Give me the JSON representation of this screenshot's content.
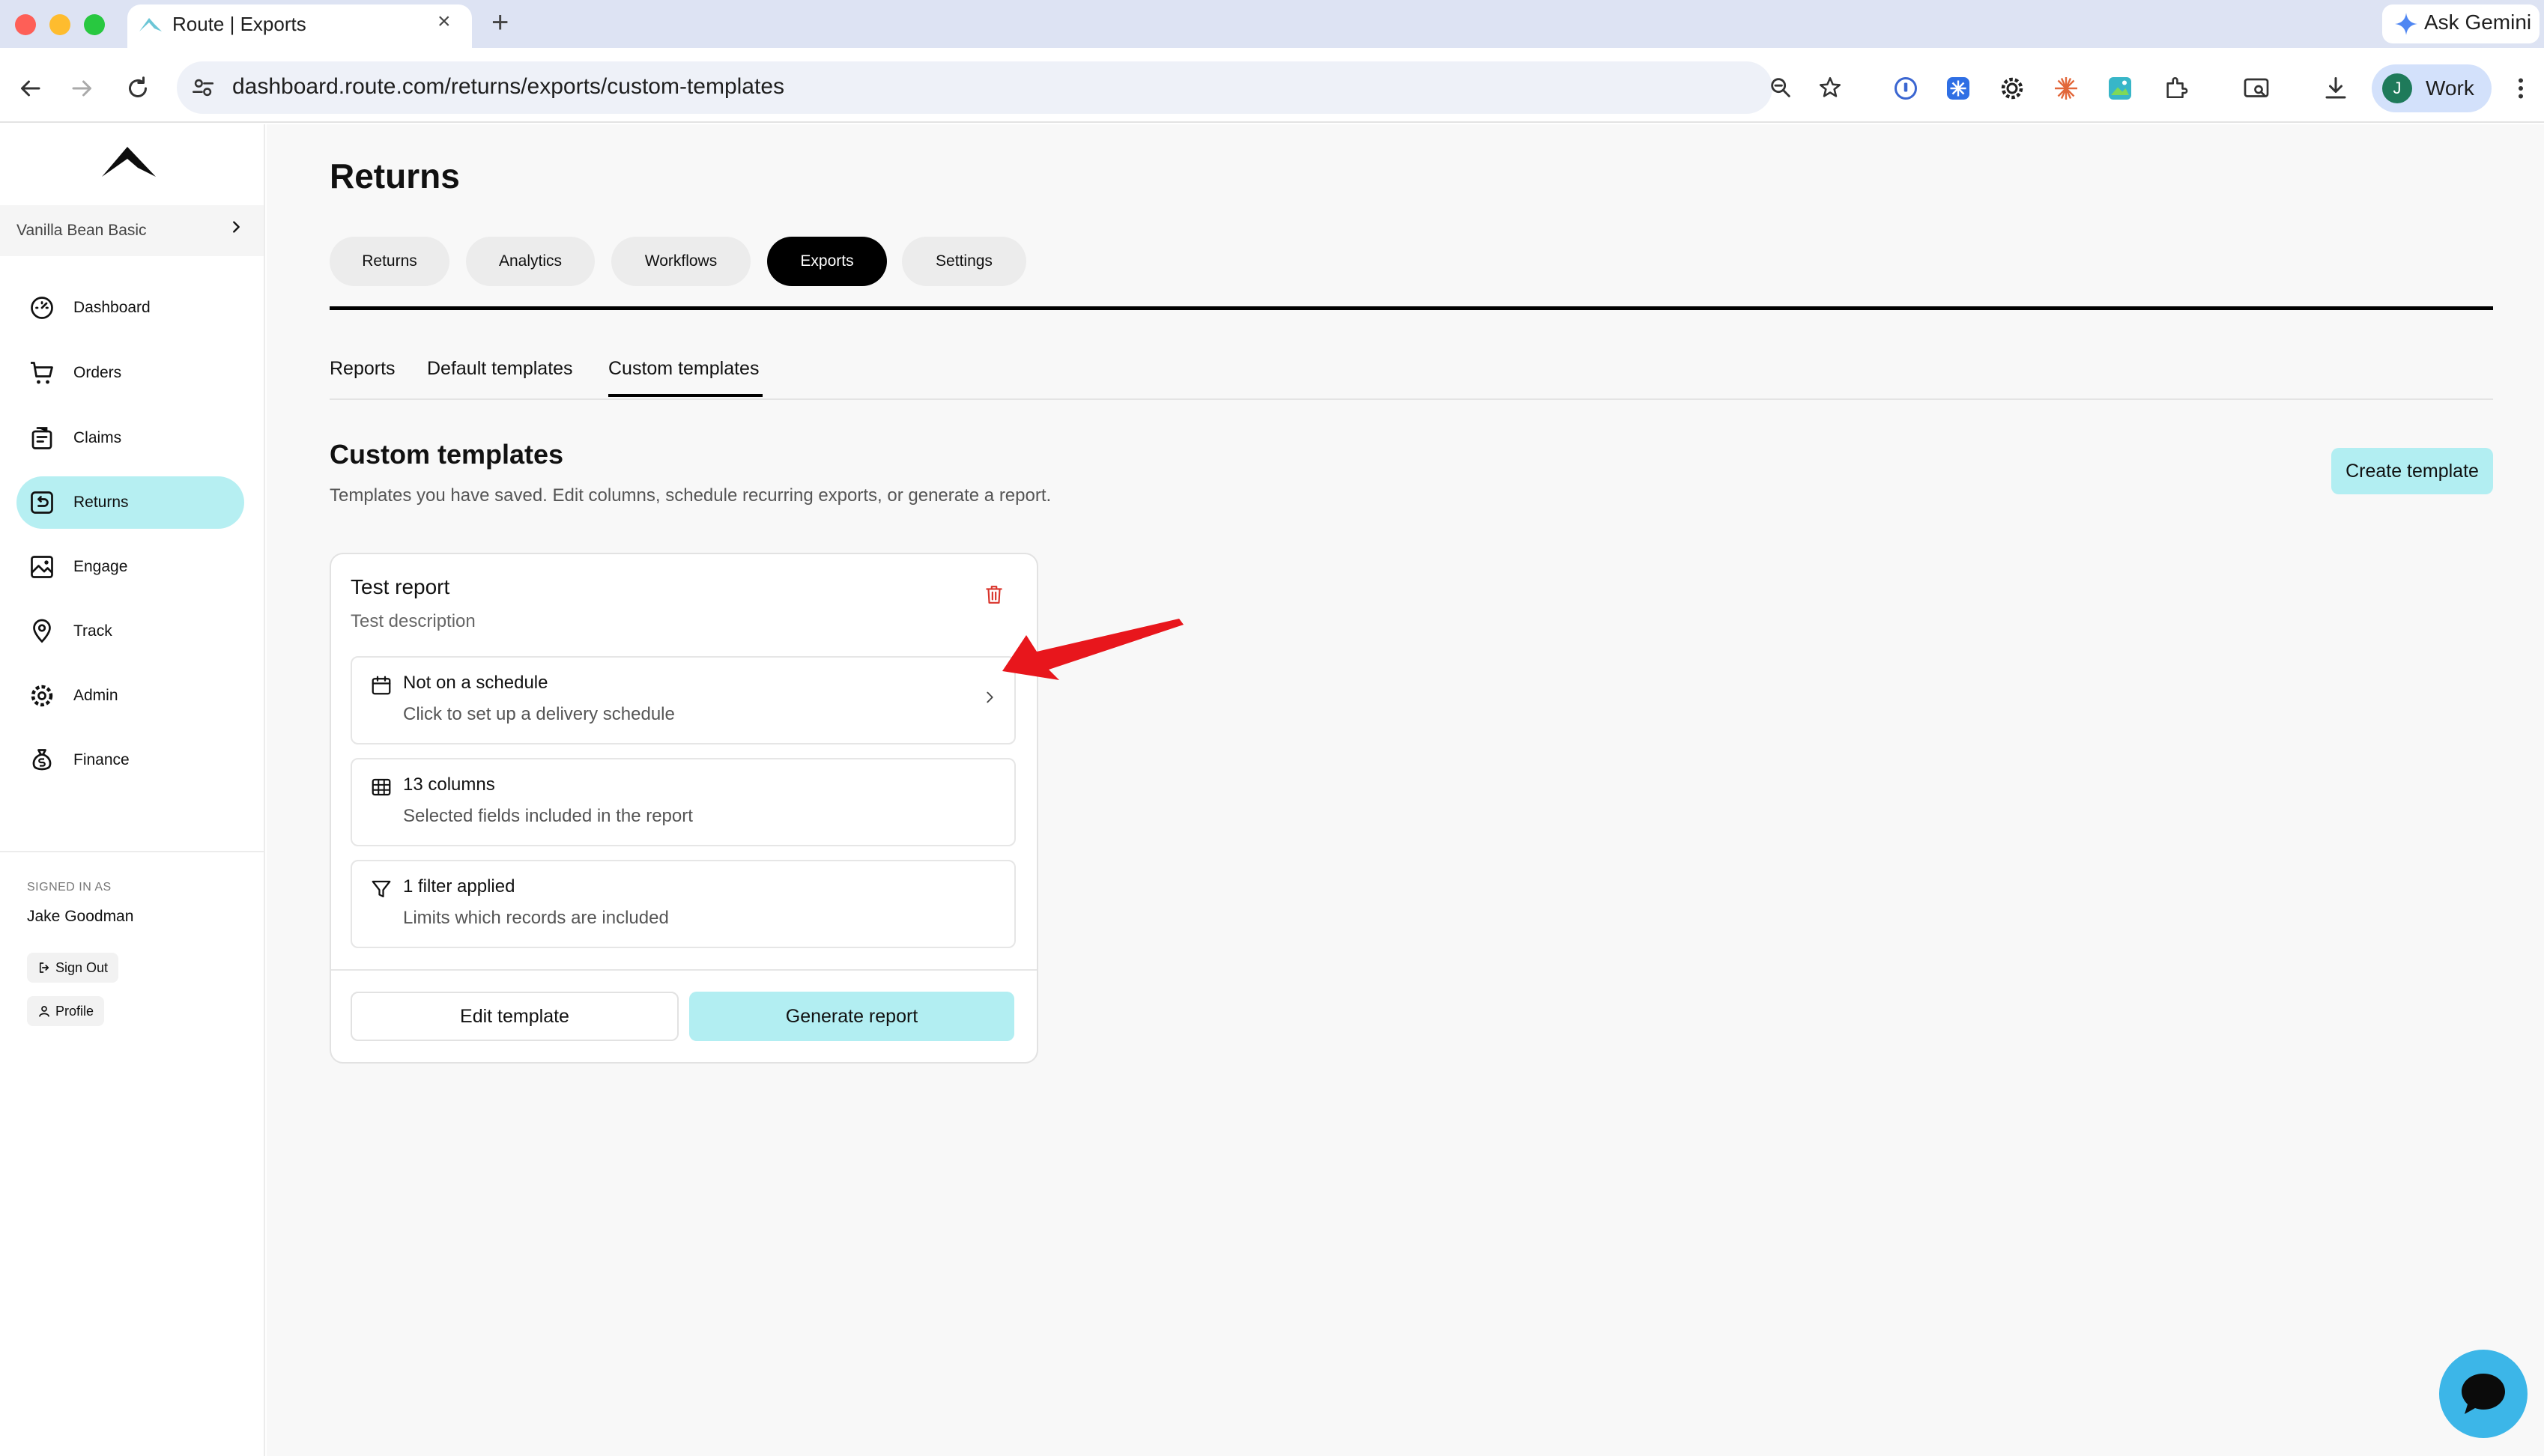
{
  "browser": {
    "tab_title": "Route | Exports",
    "url": "dashboard.route.com/returns/exports/custom-templates",
    "gemini_label": "Ask Gemini",
    "profile_initial": "J",
    "profile_label": "Work"
  },
  "sidebar": {
    "org_name": "Vanilla Bean Basic",
    "items": [
      {
        "label": "Dashboard",
        "icon": "dashboard-icon"
      },
      {
        "label": "Orders",
        "icon": "cart-icon"
      },
      {
        "label": "Claims",
        "icon": "claims-icon"
      },
      {
        "label": "Returns",
        "icon": "returns-icon",
        "active": true
      },
      {
        "label": "Engage",
        "icon": "image-icon"
      },
      {
        "label": "Track",
        "icon": "location-pin-icon"
      },
      {
        "label": "Admin",
        "icon": "gear-icon"
      },
      {
        "label": "Finance",
        "icon": "money-bag-icon"
      }
    ],
    "signed_in_caption": "SIGNED IN AS",
    "user_name": "Jake Goodman",
    "sign_out_label": "Sign Out",
    "profile_label": "Profile"
  },
  "main": {
    "title": "Returns",
    "pills": [
      "Returns",
      "Analytics",
      "Workflows",
      "Exports",
      "Settings"
    ],
    "active_pill": "Exports",
    "subtabs": [
      "Reports",
      "Default templates",
      "Custom templates"
    ],
    "active_subtab": "Custom templates",
    "section_title": "Custom templates",
    "section_desc": "Templates you have saved. Edit columns, schedule recurring exports, or generate a report.",
    "create_label": "Create template",
    "card": {
      "title": "Test report",
      "description": "Test description",
      "rows": [
        {
          "title": "Not on a schedule",
          "sub": "Click to set up a delivery schedule",
          "icon": "calendar-icon"
        },
        {
          "title": "13 columns",
          "sub": "Selected fields included in the report",
          "icon": "table-icon"
        },
        {
          "title": "1 filter applied",
          "sub": "Limits which records are included",
          "icon": "filter-icon"
        }
      ],
      "edit_label": "Edit template",
      "generate_label": "Generate report"
    }
  },
  "colors": {
    "accent": "#b2eef2",
    "active_nav": "#b6eff2",
    "chat_fab": "#3cb6e8",
    "annotation_arrow": "#e8161c",
    "delete_icon": "#d9342b"
  }
}
